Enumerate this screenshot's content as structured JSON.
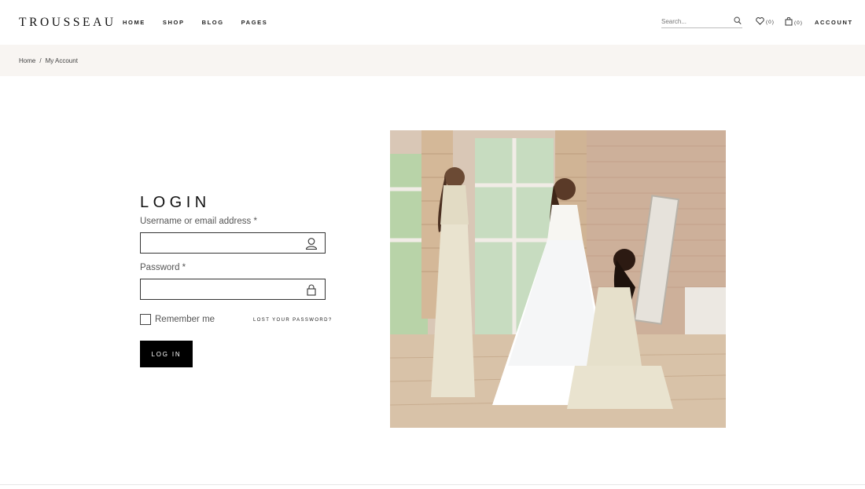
{
  "brand": {
    "logo": "TROUSSEAU"
  },
  "nav": {
    "items": [
      "HOME",
      "SHOP",
      "BLOG",
      "PAGES"
    ]
  },
  "search": {
    "placeholder": "Search..."
  },
  "wishlist": {
    "count": "(0)"
  },
  "cart": {
    "count": "(0)"
  },
  "account": {
    "label": "ACCOUNT"
  },
  "breadcrumb": {
    "home": "Home",
    "separator": "/",
    "current": "My Account"
  },
  "login": {
    "title": "LOGIN",
    "username_label": "Username or email address *",
    "username_value": "",
    "password_label": "Password *",
    "password_value": "",
    "remember_label": "Remember me",
    "remember_checked": false,
    "lost_password": "LOST YOUR PASSWORD?",
    "button": "LOG IN"
  },
  "icons": [
    "search-icon",
    "heart-icon",
    "bag-icon",
    "user-icon",
    "lock-icon"
  ],
  "colors": {
    "breadcrumb_bg": "#f8f5f2",
    "button_bg": "#000000",
    "text": "#222222"
  }
}
